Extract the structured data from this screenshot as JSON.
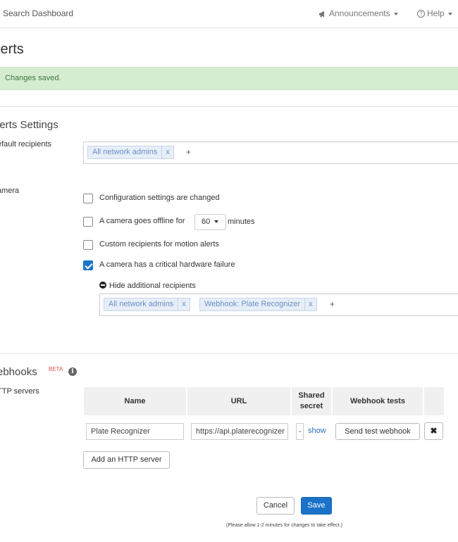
{
  "topbar": {
    "search_label": "Search Dashboard",
    "announcements_label": "Announcements",
    "help_label": "Help",
    "help_glyph": "?"
  },
  "page": {
    "title": "lerts"
  },
  "banner": {
    "message": "Changes saved."
  },
  "alerts_settings": {
    "title": "lerts Settings",
    "default_recipients": {
      "label": "efault recipients",
      "tags": [
        "All network admins"
      ],
      "remove_glyph": "x",
      "add_glyph": "+"
    },
    "camera": {
      "label": "amera",
      "options": [
        {
          "label": "Configuration settings are changed",
          "checked": false
        },
        {
          "label": "A camera goes offline for",
          "checked": false
        },
        {
          "label": "Custom recipients for motion alerts",
          "checked": false
        },
        {
          "label": "A camera has a critical hardware failure",
          "checked": true
        }
      ],
      "offline_minutes": "60",
      "minutes_label": "minutes",
      "hide_recipients_label": "Hide additional recipients",
      "additional_recipients": [
        "All network admins",
        "Webhook: Plate Recognizer"
      ]
    }
  },
  "webhooks": {
    "title": "ebhooks",
    "beta_label": "BETA",
    "info_glyph": "i",
    "http_servers_label": "TTP servers",
    "columns": [
      "Name",
      "URL",
      "Shared secret",
      "Webhook tests"
    ],
    "rows": [
      {
        "name": "Plate Recognizer",
        "url": "https://api.platerecognizer",
        "secret": "-",
        "show_label": "show",
        "test_label": "Send test webhook",
        "delete_glyph": "✖"
      }
    ],
    "add_server_label": "Add an HTTP server"
  },
  "footer": {
    "cancel_label": "Cancel",
    "save_label": "Save",
    "note": "(Please allow 1-2 minutes for changes to take effect.)"
  }
}
